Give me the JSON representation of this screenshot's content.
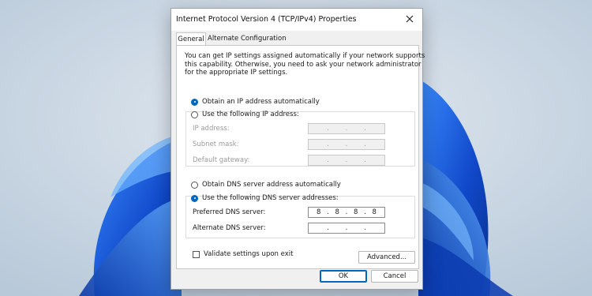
{
  "dialog": {
    "title": "Internet Protocol Version 4 (TCP/IPv4) Properties",
    "close_icon": "close-icon"
  },
  "tabs": [
    {
      "label": "General",
      "active": true
    },
    {
      "label": "Alternate Configuration",
      "active": false
    }
  ],
  "description": [
    "You can get IP settings assigned automatically if your network supports",
    "this capability. Otherwise, you need to ask your network administrator",
    "for the appropriate IP settings."
  ],
  "ip_mode": {
    "auto_label": "Obtain an IP address automatically",
    "manual_label": "Use the following IP address:",
    "selected": "auto"
  },
  "ip_fields": {
    "ip_address_label": "IP address:",
    "subnet_mask_label": "Subnet mask:",
    "default_gateway_label": "Default gateway:",
    "dot": "."
  },
  "dns_mode": {
    "auto_label": "Obtain DNS server address automatically",
    "manual_label": "Use the following DNS server addresses:",
    "selected": "manual"
  },
  "dns_fields": {
    "preferred_label": "Preferred DNS server:",
    "preferred_octets": [
      "8",
      "8",
      "8",
      "8"
    ],
    "alternate_label": "Alternate DNS server:",
    "dot": "."
  },
  "validate_label": "Validate settings upon exit",
  "validate_checked": false,
  "buttons": {
    "advanced": "Advanced...",
    "ok": "OK",
    "cancel": "Cancel"
  },
  "colors": {
    "accent": "#0067c0",
    "wallpaper_blue": "#1e5fd6"
  }
}
